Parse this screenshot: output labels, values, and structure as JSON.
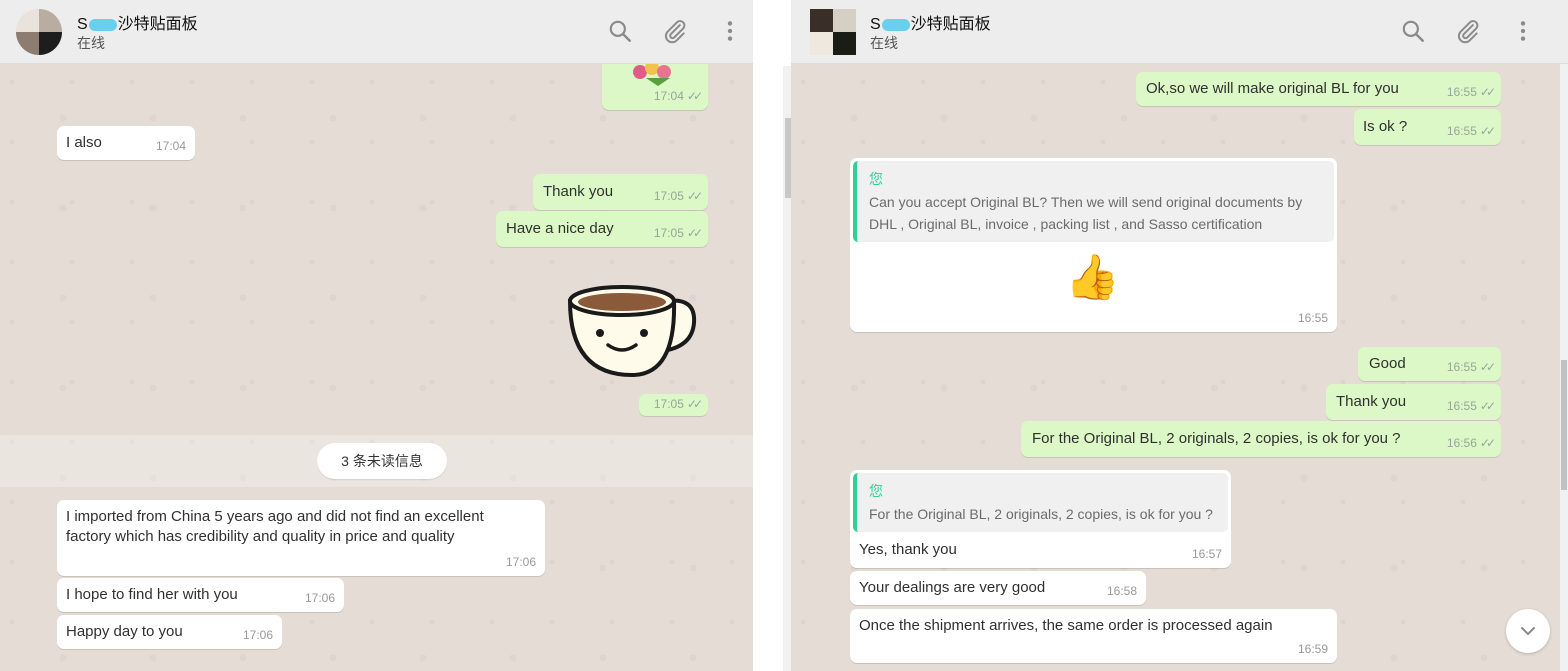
{
  "left": {
    "header": {
      "name_prefix": "S",
      "name_suffix": "沙特贴面板",
      "status": "在线"
    },
    "messages": [
      {
        "id": "l1",
        "text": "",
        "time": "17:04",
        "ticks": "✓✓"
      },
      {
        "id": "l2",
        "text": "I also",
        "time": "17:04"
      },
      {
        "id": "l3",
        "text": "Thank you",
        "time": "17:05",
        "ticks": "✓✓"
      },
      {
        "id": "l4",
        "text": "Have a nice day",
        "time": "17:05",
        "ticks": "✓✓"
      },
      {
        "id": "l5",
        "text": "",
        "time": "17:05",
        "ticks": "✓✓"
      },
      {
        "id": "l6",
        "text": "I imported from China 5 years ago and did not find an excellent factory which has credibility and quality in price and quality",
        "time": "17:06"
      },
      {
        "id": "l7",
        "text": "I hope to find her with you",
        "time": "17:06"
      },
      {
        "id": "l8",
        "text": "Happy day to you",
        "time": "17:06"
      }
    ],
    "unread_label": "3 条未读信息"
  },
  "right": {
    "header": {
      "name_prefix": "S",
      "name_suffix": "沙特贴面板",
      "status": "在线"
    },
    "messages": [
      {
        "id": "r1",
        "text": "Ok,so we will make original BL for you",
        "time": "16:55",
        "ticks": "✓✓"
      },
      {
        "id": "r2",
        "text": "Is ok ?",
        "time": "16:55",
        "ticks": "✓✓"
      },
      {
        "id": "r3",
        "quote_author": "您",
        "quote_text": "Can you accept Original BL? Then we will send original documents by DHL , Original BL, invoice , packing list , and  Sasso certification",
        "emoji": "👍",
        "time": "16:55"
      },
      {
        "id": "r4",
        "text": "Good",
        "time": "16:55",
        "ticks": "✓✓"
      },
      {
        "id": "r5",
        "text": "Thank you",
        "time": "16:55",
        "ticks": "✓✓"
      },
      {
        "id": "r6",
        "text": "For the Original BL, 2 originals, 2 copies, is ok for you ?",
        "time": "16:56",
        "ticks": "✓✓"
      },
      {
        "id": "r7",
        "quote_author": "您",
        "quote_text": "For the Original BL, 2 originals, 2 copies, is ok for you ?",
        "text": "Yes, thank you",
        "time": "16:57"
      },
      {
        "id": "r8",
        "text": "Your dealings are very good",
        "time": "16:58"
      },
      {
        "id": "r9",
        "text": "Once the shipment arrives, the same order is processed again",
        "time": "16:59"
      }
    ]
  },
  "icons": {
    "search": "search-icon",
    "attach": "paperclip-icon",
    "menu": "more-vertical-icon",
    "scroll": "chevron-down-icon"
  },
  "colors": {
    "outgoing": "#dcf8c6",
    "incoming": "#ffffff",
    "quote_accent": "#35cd96",
    "chat_bg": "#e5ddd5",
    "header_bg": "#ededed"
  }
}
